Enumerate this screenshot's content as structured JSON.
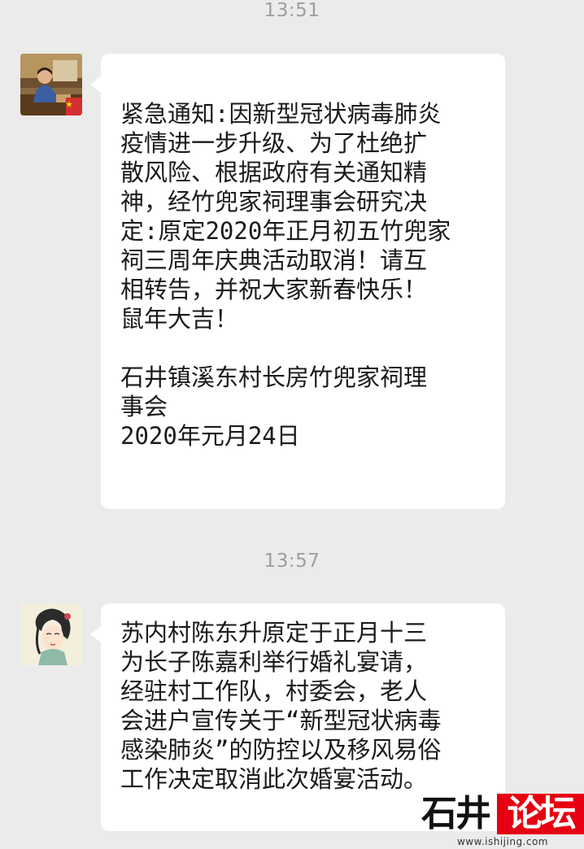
{
  "chat": {
    "messages": [
      {
        "time": "13:51",
        "avatar": "avatar-photo-woman-flag",
        "text": "紧急通知:因新型冠状病毒肺炎\n疫情进一步升级、为了杜绝扩\n散风险、根据政府有关通知精\n神，经竹兜家祠理事会研究决\n定:原定2020年正月初五竹兜家\n祠三周年庆典活动取消！请互\n相转告，并祝大家新春快乐！\n鼠年大吉！\n\n石井镇溪东村长房竹兜家祠理\n事会\n2020年元月24日"
      },
      {
        "time": "13:57",
        "avatar": "avatar-illustration-girl",
        "text": "苏内村陈东升原定于正月十三\n为长子陈嘉利举行婚礼宴请，\n经驻村工作队，村委会，老人\n会进户宣传关于“新型冠状病毒\n感染肺炎”的防控以及移风易俗\n工作决定取消此次婚宴活动。"
      }
    ]
  },
  "watermark": {
    "left_text": "石井",
    "right_text": "论坛",
    "url": "www.ishijing.com",
    "brand_color": "#e60012"
  },
  "colors": {
    "background": "#ebebeb",
    "bubble": "#ffffff",
    "timestamp": "#9e9e9e"
  }
}
